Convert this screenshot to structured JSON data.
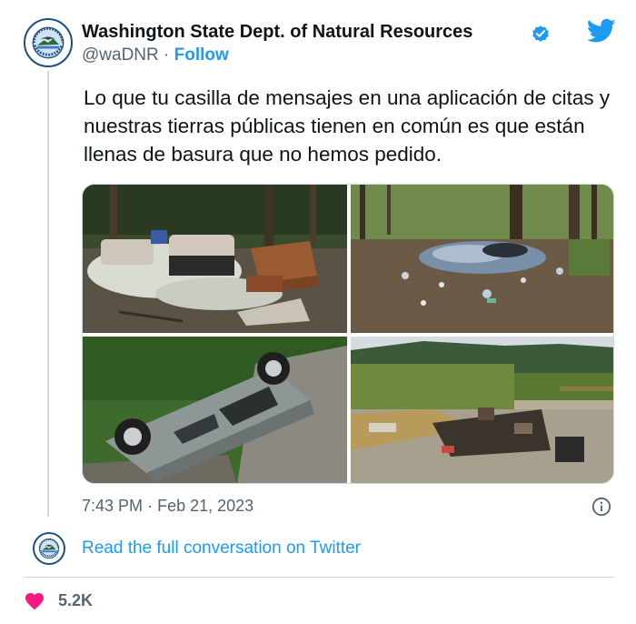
{
  "author": {
    "name": "Washington State Dept. of Natural Resources",
    "handle": "@waDNR",
    "separator": "·",
    "follow_label": "Follow"
  },
  "tweet": {
    "text": "Lo que tu casilla de mensajes en una aplicación de citas y nuestras tierras públicas tienen en común es que están llenas de basura que no hemos pedido."
  },
  "media": {
    "count": 4
  },
  "meta": {
    "time": "7:43 PM",
    "separator": "·",
    "date": "Feb 21, 2023"
  },
  "footer": {
    "read_label": "Read the full conversation on Twitter",
    "likes": "5.2K"
  },
  "colors": {
    "accent": "#1d9bf0",
    "text": "#0f1419",
    "secondary": "#536471",
    "like": "#f91880",
    "border": "#cfd9de"
  },
  "icons": {
    "verified": "verified-badge-icon",
    "brand": "twitter-bird-icon",
    "info": "info-icon",
    "like": "heart-icon"
  }
}
